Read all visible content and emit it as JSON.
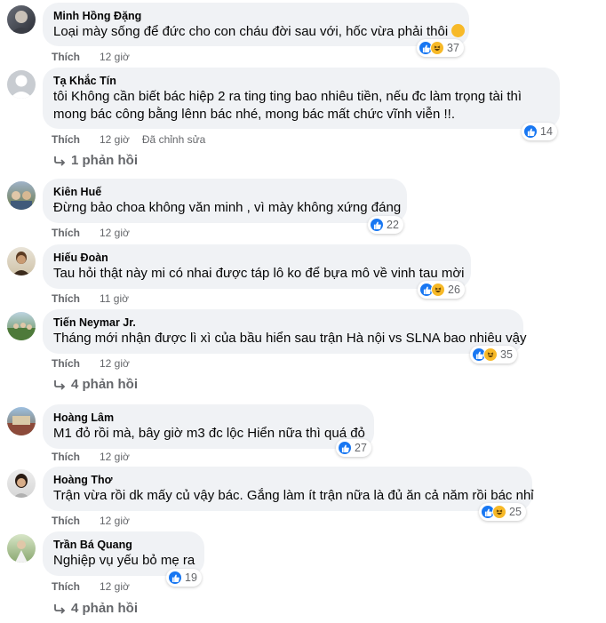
{
  "comments": [
    {
      "author": "Minh Hồng Đặng",
      "text": "Loại mày sống để đức cho con cháu đời sau với, hốc vừa phải thôi",
      "like_label": "Thích",
      "time": "12 giờ",
      "reaction_count": "37",
      "reaction_icons": [
        "like-icon",
        "haha-icon"
      ]
    },
    {
      "author": "Tạ Khắc Tín",
      "text_lines": [
        "tôi Không cần biết bác hiệp 2 ra ting ting bao nhiêu tiền, nếu đc làm trọng tài thì",
        "mong bác công bằng lênn bác nhé, mong bác mất chức vĩnh viễn !!."
      ],
      "like_label": "Thích",
      "time": "12 giờ",
      "edited": "Đã chỉnh sửa",
      "reaction_count": "14",
      "reaction_icons": [
        "like-icon"
      ],
      "replies": "1 phản hồi"
    },
    {
      "author": "Kiên Huế",
      "text": "Đừng bảo choa không văn minh , vì mày không xứng đáng",
      "like_label": "Thích",
      "time": "12 giờ",
      "reaction_count": "22",
      "reaction_icons": [
        "like-icon"
      ]
    },
    {
      "author": "Hiếu Đoàn",
      "text": "Tau hỏi thật này mi có nhai được táp lô ko để bựa mô về vinh tau mời",
      "like_label": "Thích",
      "time": "11 giờ",
      "reaction_count": "26",
      "reaction_icons": [
        "like-icon",
        "haha-icon"
      ]
    },
    {
      "author": "Tiến Neymar Jr.",
      "text": "Tháng mới nhận được lì xì của bầu hiển sau trận Hà nội vs SLNA bao nhiêu vậy",
      "like_label": "Thích",
      "time": "12 giờ",
      "reaction_count": "35",
      "reaction_icons": [
        "like-icon",
        "haha-icon"
      ],
      "replies": "4 phản hồi"
    },
    {
      "author": "Hoàng Lâm",
      "text": "M1 đỏ rồi mà, bây giờ m3 đc lộc Hiển nữa thì quá đỏ",
      "like_label": "Thích",
      "time": "12 giờ",
      "reaction_count": "27",
      "reaction_icons": [
        "like-icon"
      ]
    },
    {
      "author": "Hoàng Thơ",
      "text": "Trận vừa rồi dk mấy củ vậy bác. Gắng làm ít trận nữa là đủ ăn cả năm rồi bác nhỉ",
      "like_label": "Thích",
      "time": "12 giờ",
      "reaction_count": "25",
      "reaction_icons": [
        "like-icon",
        "haha-icon"
      ]
    },
    {
      "author": "Trần Bá Quang",
      "text": "Nghiệp vụ yếu bỏ mẹ ra",
      "like_label": "Thích",
      "time": "12 giờ",
      "reaction_count": "19",
      "reaction_icons": [
        "like-icon"
      ],
      "replies": "4 phản hồi"
    }
  ],
  "colors": {
    "bubble": "#f0f2f5",
    "like": "#1877f2",
    "haha": "#f7b928",
    "meta": "#65676b"
  }
}
